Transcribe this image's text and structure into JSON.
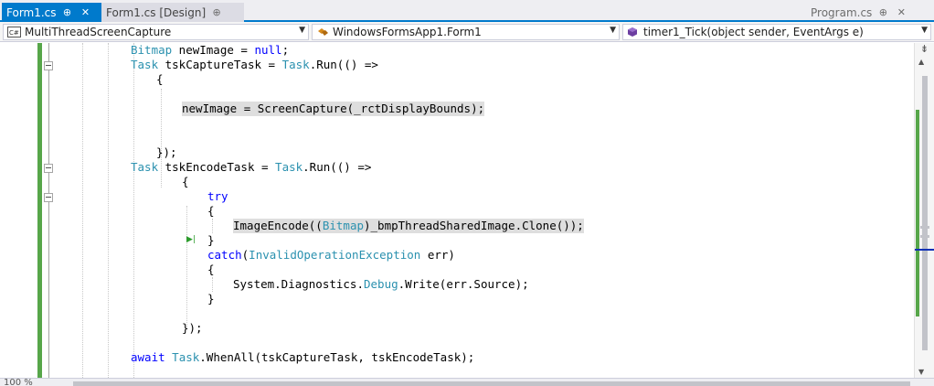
{
  "tabs": [
    {
      "label": "Form1.cs",
      "pin": "⊕",
      "close": "✕"
    },
    {
      "label": "Form1.cs [Design]",
      "pin": "⊕"
    }
  ],
  "right_tab": {
    "label": "Program.cs",
    "pin": "⊕",
    "close": "✕"
  },
  "nav": {
    "project": "MultiThreadScreenCapture",
    "type": "WindowsFormsApp1.Form1",
    "member": "timer1_Tick(object sender, EventArgs e)"
  },
  "code": {
    "l1": {
      "t1": "Bitmap",
      "t2": " newImage = ",
      "k1": "null",
      "t3": ";"
    },
    "l2": {
      "t1": "Task",
      "t2": " tskCaptureTask = ",
      "t3": "Task",
      "t4": ".Run(() =>"
    },
    "l3": "{",
    "l5": "newImage = ScreenCapture(_rctDisplayBounds);",
    "l8": "});",
    "l9": {
      "t1": "Task",
      "t2": " tskEncodeTask = ",
      "t3": "Task",
      "t4": ".Run(() =>"
    },
    "l10": "{",
    "l11": "try",
    "l12": "{",
    "l13": {
      "p1": "ImageEncode((",
      "p2": "Bitmap",
      "p3": ")_bmpThreadSharedImage.Clone());"
    },
    "l14": "}",
    "l15": {
      "k1": "catch",
      "t1": "(",
      "t2": "InvalidOperationException",
      "t3": " err)"
    },
    "l16": "{",
    "l17": {
      "p1": "System.Diagnostics.",
      "p2": "Debug",
      "p3": ".Write(err.Source);"
    },
    "l18": "}",
    "l20": "});",
    "l22": {
      "k1": "await",
      "t1": " ",
      "t2": "Task",
      "t3": ".WhenAll(tskCaptureTask, tskEncodeTask);"
    }
  },
  "status": {
    "zoom": "100 %"
  },
  "colors": {
    "accent": "#007acc",
    "keyword": "#0000ff",
    "type": "#2b91af",
    "change_margin": "#57a64a",
    "highlight": "#dedede"
  },
  "icons": [
    "tab-pin-icon",
    "tab-close-icon",
    "csharp-project-icon",
    "class-icon",
    "method-icon",
    "chevron-down-icon",
    "next-statement-icon",
    "split-view-icon"
  ]
}
